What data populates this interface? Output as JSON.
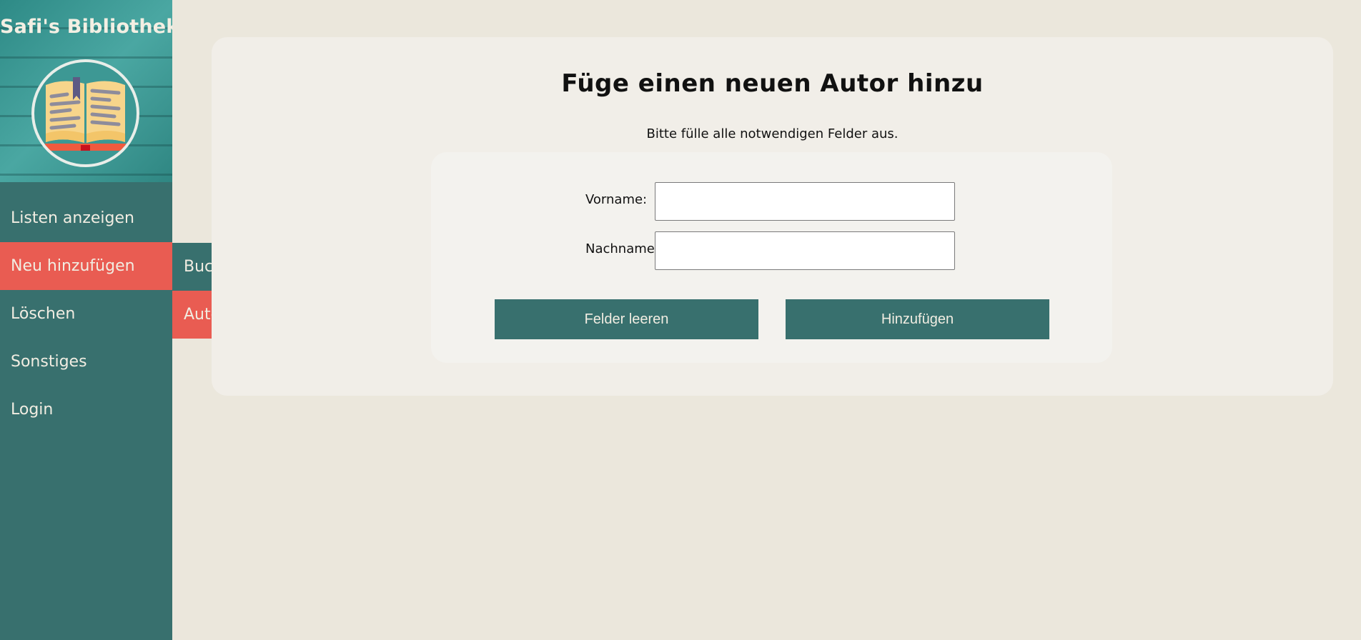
{
  "app": {
    "brand_title": "Safi's Bibliothek",
    "logo_icon": "open-book-icon"
  },
  "sidebar": {
    "items": [
      {
        "label": "Listen anzeigen",
        "active": false
      },
      {
        "label": "Neu hinzufügen",
        "active": true
      },
      {
        "label": "Löschen",
        "active": false
      },
      {
        "label": "Sonstiges",
        "active": false
      },
      {
        "label": "Login",
        "active": false
      }
    ],
    "submenu": [
      {
        "label": "Buch hinzufügen",
        "active": false
      },
      {
        "label": "Autor hinzufügen",
        "active": true
      }
    ]
  },
  "main": {
    "title": "Füge einen neuen Autor hinzu",
    "hint": "Bitte fülle alle notwendigen Felder aus.",
    "form": {
      "firstname_label": "Vorname:",
      "firstname_value": "",
      "lastname_label": "Nachname:",
      "lastname_value": "",
      "clear_label": "Felder leeren",
      "submit_label": "Hinzufügen"
    }
  },
  "colors": {
    "page_background": "#ebe7dc",
    "sidebar": "#38706e",
    "accent_active": "#e95c52",
    "panel": "#f1eee8",
    "button": "#38706e",
    "nav_text": "#f1ede2"
  }
}
